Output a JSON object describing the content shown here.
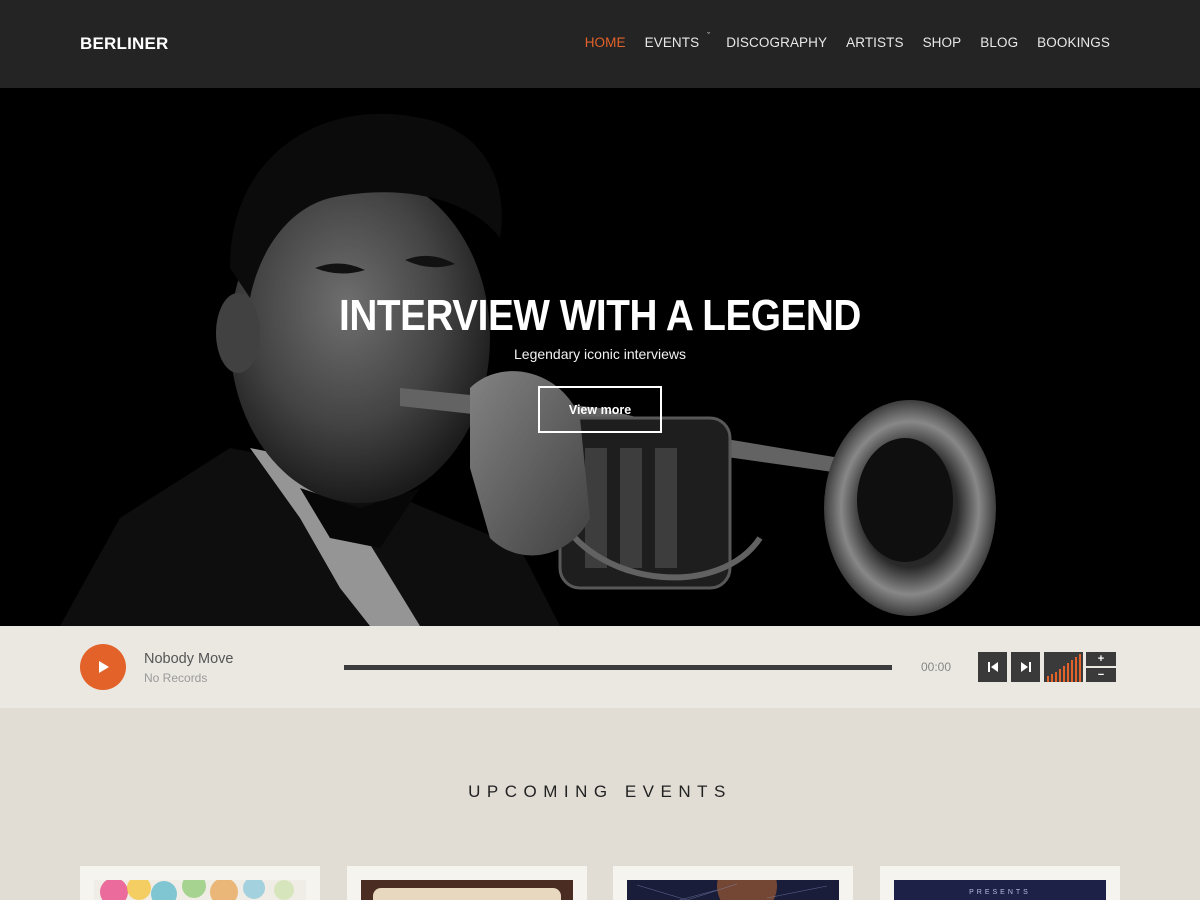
{
  "brand": {
    "logo": "BERLINER"
  },
  "nav": {
    "items": [
      {
        "label": "HOME",
        "active": true
      },
      {
        "label": "EVENTS",
        "active": false,
        "dropdown": true
      },
      {
        "label": "DISCOGRAPHY",
        "active": false
      },
      {
        "label": "ARTISTS",
        "active": false
      },
      {
        "label": "SHOP",
        "active": false
      },
      {
        "label": "BLOG",
        "active": false
      },
      {
        "label": "BOOKINGS",
        "active": false
      }
    ]
  },
  "hero": {
    "title": "INTERVIEW WITH A LEGEND",
    "subtitle": "Legendary iconic interviews",
    "button_label": "View more"
  },
  "player": {
    "track_title": "Nobody Move",
    "album": "No Records",
    "time": "00:00",
    "progress": 0,
    "volume_up_label": "+",
    "volume_down_label": "−"
  },
  "events": {
    "heading": "UPCOMING EVENTS",
    "cards": [
      {
        "theme": "watercolor"
      },
      {
        "theme": "brown-frame"
      },
      {
        "theme": "starfield"
      },
      {
        "theme": "navy-poster",
        "caption": "PRESENTS"
      }
    ]
  },
  "colors": {
    "accent": "#e2622a",
    "header_bg": "#242424",
    "player_bg": "#ebe8e1",
    "page_bg": "#e1ddd5"
  }
}
